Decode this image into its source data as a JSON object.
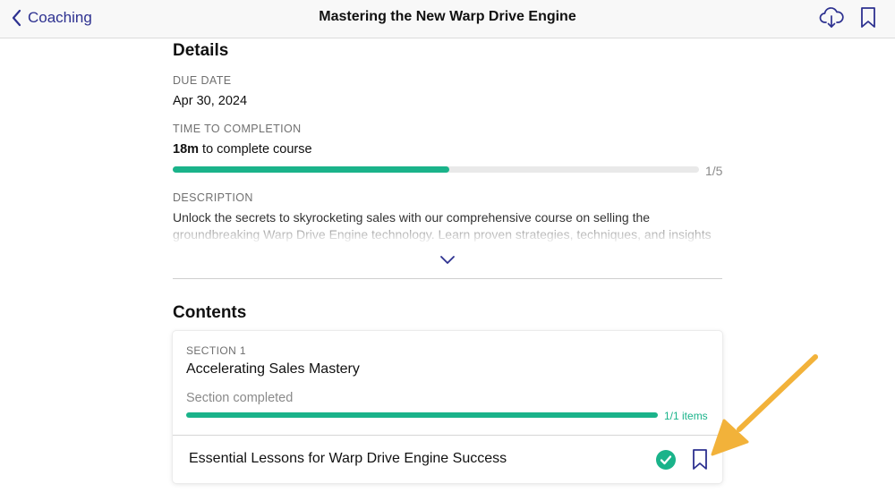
{
  "header": {
    "back_label": "Coaching",
    "title": "Mastering the New Warp Drive Engine"
  },
  "details": {
    "heading": "Details",
    "due_date_label": "DUE DATE",
    "due_date": "Apr 30, 2024",
    "time_label": "TIME TO COMPLETION",
    "time_value": "18m",
    "time_suffix": " to complete course",
    "progress_count": "1/5",
    "description_label": "DESCRIPTION",
    "description": "Unlock the secrets to skyrocketing sales with our comprehensive course on selling the groundbreaking Warp Drive Engine technology. Learn proven strategies, techniques, and insights"
  },
  "contents": {
    "heading": "Contents",
    "section": {
      "label": "SECTION 1",
      "title": "Accelerating Sales Mastery",
      "status": "Section completed",
      "items_count": "1/1 items"
    },
    "lesson": {
      "title": "Essential Lessons for Warp Drive Engine Success"
    }
  },
  "colors": {
    "accent": "#2d3190",
    "progress": "#1ab38a",
    "annotation_arrow": "#f2b23a"
  },
  "icons": [
    "chevron-left-icon",
    "cloud-download-icon",
    "bookmark-icon",
    "chevron-down-icon",
    "check-circle-icon"
  ]
}
